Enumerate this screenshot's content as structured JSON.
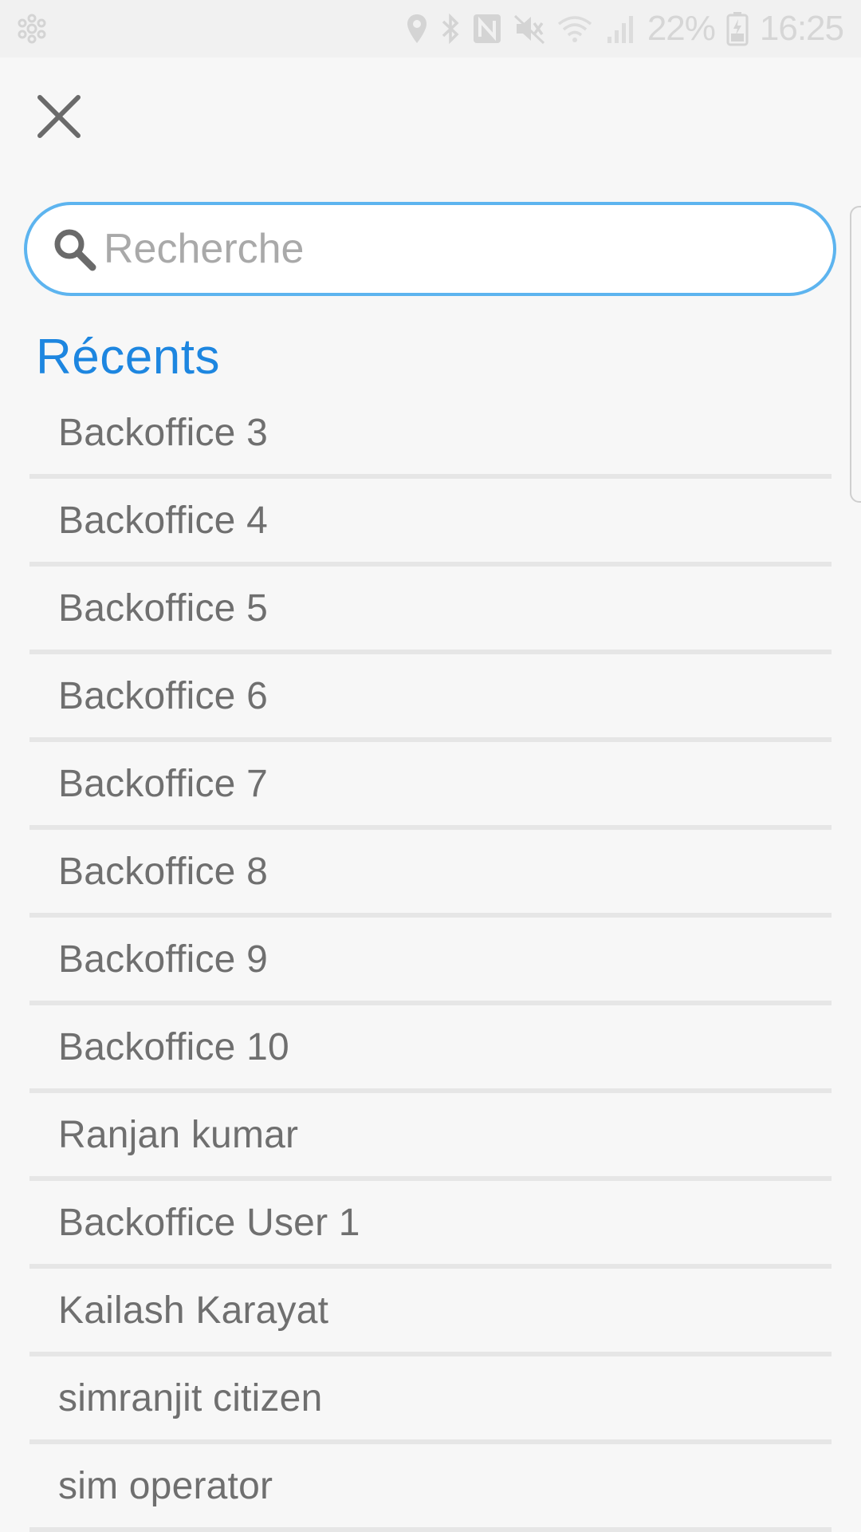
{
  "status_bar": {
    "battery": "22%",
    "time": "16:25",
    "icons": [
      "location-icon",
      "bluetooth-icon",
      "nfc-icon",
      "mute-icon",
      "wifi-icon",
      "signal-icon",
      "battery-icon"
    ]
  },
  "close": {
    "icon": "close-icon"
  },
  "search": {
    "placeholder": "Recherche",
    "value": "",
    "border_color": "#5db4ef"
  },
  "recents": {
    "title": "Récents",
    "title_color": "#1d86e0",
    "items": [
      {
        "label": "Backoffice 3"
      },
      {
        "label": "Backoffice 4"
      },
      {
        "label": "Backoffice 5"
      },
      {
        "label": "Backoffice 6"
      },
      {
        "label": "Backoffice 7"
      },
      {
        "label": "Backoffice 8"
      },
      {
        "label": "Backoffice 9"
      },
      {
        "label": "Backoffice 10"
      },
      {
        "label": "Ranjan kumar"
      },
      {
        "label": "Backoffice User 1"
      },
      {
        "label": "Kailash Karayat"
      },
      {
        "label": "simranjit citizen"
      },
      {
        "label": "sim operator"
      }
    ]
  }
}
